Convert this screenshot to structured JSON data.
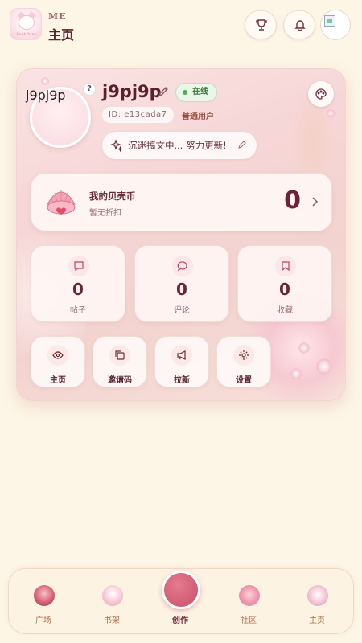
{
  "header": {
    "logo_caption": "bookBuny",
    "subtitle": "ME",
    "title": "主页"
  },
  "profile": {
    "avatar_text": "j9pj9p",
    "help_badge": "?",
    "username": "j9pj9p",
    "online_status": "在线",
    "id_text": "ID: e13cada7",
    "role": "普通用户",
    "status_message": "沉迷搞文中... 努力更新!"
  },
  "coins": {
    "title": "我的贝壳币",
    "subtitle": "暂无折扣",
    "value": "0"
  },
  "stats": [
    {
      "label": "帖子",
      "value": "0",
      "icon": "chat-bubble-icon"
    },
    {
      "label": "评论",
      "value": "0",
      "icon": "comment-icon"
    },
    {
      "label": "收藏",
      "value": "0",
      "icon": "bookmark-icon"
    }
  ],
  "actions": [
    {
      "label": "主页",
      "icon": "eye-icon"
    },
    {
      "label": "邀请码",
      "icon": "copy-icon"
    },
    {
      "label": "拉新",
      "icon": "megaphone-icon"
    },
    {
      "label": "设置",
      "icon": "gear-icon"
    }
  ],
  "nav": [
    {
      "label": "广场",
      "icon": "plaza-icon"
    },
    {
      "label": "书架",
      "icon": "bookshelf-icon"
    },
    {
      "label": "创作",
      "icon": "create-icon"
    },
    {
      "label": "社区",
      "icon": "community-icon"
    },
    {
      "label": "主页",
      "icon": "home-cat-icon"
    }
  ],
  "colors": {
    "background": "#fdf5e6",
    "accent": "#6b2336",
    "online": "#4caf50",
    "create_button": "#c75068"
  }
}
